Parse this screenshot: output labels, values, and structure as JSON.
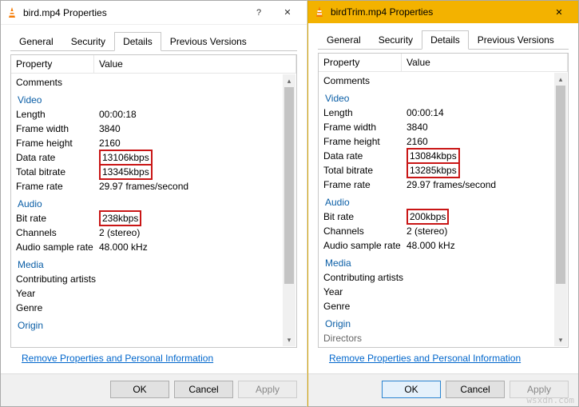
{
  "watermark": "wsxdn.com",
  "left": {
    "title": "bird.mp4 Properties",
    "headers": {
      "prop": "Property",
      "val": "Value"
    },
    "tabs": {
      "general": "General",
      "security": "Security",
      "details": "Details",
      "previous": "Previous Versions"
    },
    "sections": {
      "comments": "Comments",
      "video": "Video",
      "audio": "Audio",
      "media": "Media",
      "origin": "Origin"
    },
    "video": {
      "length_l": "Length",
      "length_v": "00:00:18",
      "fw_l": "Frame width",
      "fw_v": "3840",
      "fh_l": "Frame height",
      "fh_v": "2160",
      "dr_l": "Data rate",
      "dr_v": "13106kbps",
      "tb_l": "Total bitrate",
      "tb_v": "13345kbps",
      "fr_l": "Frame rate",
      "fr_v": "29.97 frames/second"
    },
    "audio": {
      "br_l": "Bit rate",
      "br_v": "238kbps",
      "ch_l": "Channels",
      "ch_v": "2 (stereo)",
      "sr_l": "Audio sample rate",
      "sr_v": "48.000 kHz"
    },
    "media": {
      "ca_l": "Contributing artists",
      "yr_l": "Year",
      "gn_l": "Genre"
    },
    "link": "Remove Properties and Personal Information",
    "buttons": {
      "ok": "OK",
      "cancel": "Cancel",
      "apply": "Apply"
    }
  },
  "right": {
    "title": "birdTrim.mp4 Properties",
    "headers": {
      "prop": "Property",
      "val": "Value"
    },
    "tabs": {
      "general": "General",
      "security": "Security",
      "details": "Details",
      "previous": "Previous Versions"
    },
    "sections": {
      "comments": "Comments",
      "video": "Video",
      "audio": "Audio",
      "media": "Media",
      "origin": "Origin"
    },
    "video": {
      "length_l": "Length",
      "length_v": "00:00:14",
      "fw_l": "Frame width",
      "fw_v": "3840",
      "fh_l": "Frame height",
      "fh_v": "2160",
      "dr_l": "Data rate",
      "dr_v": "13084kbps",
      "tb_l": "Total bitrate",
      "tb_v": "13285kbps",
      "fr_l": "Frame rate",
      "fr_v": "29.97 frames/second"
    },
    "audio": {
      "br_l": "Bit rate",
      "br_v": "200kbps",
      "ch_l": "Channels",
      "ch_v": "2 (stereo)",
      "sr_l": "Audio sample rate",
      "sr_v": "48.000 kHz"
    },
    "media": {
      "ca_l": "Contributing artists",
      "yr_l": "Year",
      "gn_l": "Genre"
    },
    "origin_extra": {
      "dir_l": "Directors"
    },
    "link": "Remove Properties and Personal Information",
    "buttons": {
      "ok": "OK",
      "cancel": "Cancel",
      "apply": "Apply"
    }
  }
}
